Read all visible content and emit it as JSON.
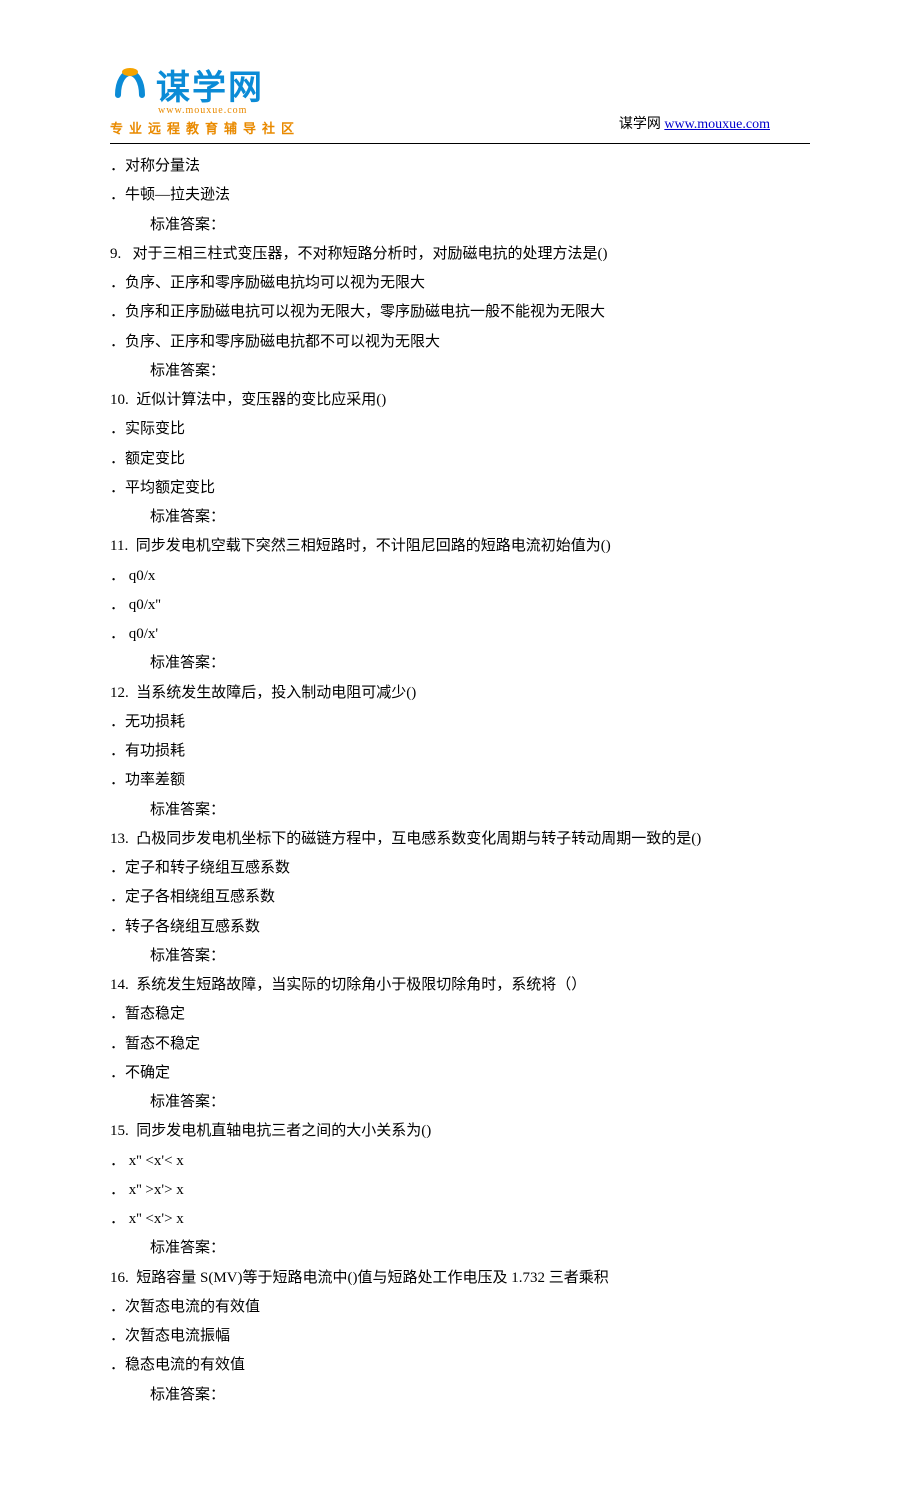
{
  "header": {
    "logo_main": "谋学网",
    "logo_url": "www.mouxue.com",
    "logo_sub": "专业远程教育辅导社区",
    "right_prefix": "谋学网 ",
    "right_link_text": "www.mouxue.com",
    "right_link_href": "http://www.mouxue.com"
  },
  "preamble": [
    "．对称分量法",
    "．牛顿—拉夫逊法"
  ],
  "answer_label": "标准答案：",
  "questions": [
    {
      "num": "9.",
      "text": "对于三相三柱式变压器，不对称短路分析时，对励磁电抗的处理方法是()",
      "options": [
        "．负序、正序和零序励磁电抗均可以视为无限大",
        "．负序和正序励磁电抗可以视为无限大，零序励磁电抗一般不能视为无限大",
        "．负序、正序和零序励磁电抗都不可以视为无限大"
      ]
    },
    {
      "num": "10.",
      "text": "近似计算法中，变压器的变比应采用()",
      "options": [
        "．实际变比",
        "．额定变比",
        "．平均额定变比"
      ]
    },
    {
      "num": "11.",
      "text": "同步发电机空载下突然三相短路时，不计阻尼回路的短路电流初始值为()",
      "options": [
        "． q0/x",
        "． q0/x''",
        "． q0/x'"
      ]
    },
    {
      "num": "12.",
      "text": "当系统发生故障后，投入制动电阻可减少()",
      "options": [
        "．无功损耗",
        "．有功损耗",
        "．功率差额"
      ]
    },
    {
      "num": "13.",
      "text": "凸极同步发电机坐标下的磁链方程中，互电感系数变化周期与转子转动周期一致的是()",
      "options": [
        "．定子和转子绕组互感系数",
        "．定子各相绕组互感系数",
        "．转子各绕组互感系数"
      ]
    },
    {
      "num": "14.",
      "text": "系统发生短路故障，当实际的切除角小于极限切除角时，系统将（）",
      "options": [
        "．暂态稳定",
        "．暂态不稳定",
        "．不确定"
      ]
    },
    {
      "num": "15.",
      "text": "同步发电机直轴电抗三者之间的大小关系为()",
      "options": [
        "． x'' <x'< x",
        "． x'' >x'> x",
        "． x'' <x'> x"
      ]
    },
    {
      "num": "16.",
      "text": "短路容量 S(MV)等于短路电流中()值与短路处工作电压及 1.732 三者乘积",
      "options": [
        "．次暂态电流的有效值",
        "．次暂态电流振幅",
        "．稳态电流的有效值"
      ]
    }
  ]
}
